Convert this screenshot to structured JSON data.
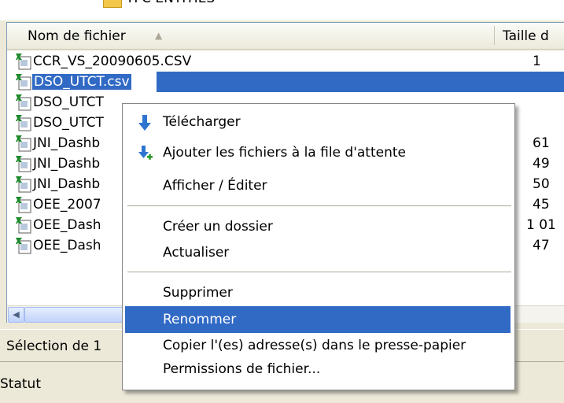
{
  "top_strip": {
    "clipped_text": "TFC ENTITIES"
  },
  "file_list": {
    "columns": [
      "Nom de fichier",
      "Taille d"
    ],
    "rows": [
      {
        "name": "CCR_VS_20090605.CSV",
        "size": "1"
      },
      {
        "name": "DSO_UTCT.csv",
        "size": ""
      },
      {
        "name": "DSO_UTCT",
        "size": ""
      },
      {
        "name": "DSO_UTCT",
        "size": ""
      },
      {
        "name": "JNI_Dashb",
        "size": "61"
      },
      {
        "name": "JNI_Dashb",
        "size": "49"
      },
      {
        "name": "JNI_Dashb",
        "size": "50"
      },
      {
        "name": "OEE_2007",
        "size": "45"
      },
      {
        "name": "OEE_Dash",
        "size": "1 01"
      },
      {
        "name": "OEE_Dash",
        "size": "47"
      }
    ]
  },
  "selection_status": "Sélection de 1",
  "status_label": "Statut",
  "context_menu": {
    "items": [
      {
        "label": "Télécharger"
      },
      {
        "label": "Ajouter les fichiers à la file d'attente"
      },
      {
        "label": "Afficher / Éditer"
      },
      {
        "label": "Créer un dossier"
      },
      {
        "label": "Actualiser"
      },
      {
        "label": "Supprimer"
      },
      {
        "label": "Renommer"
      },
      {
        "label": "Copier l'(es) adresse(s) dans le presse-papier"
      },
      {
        "label": "Permissions de fichier..."
      }
    ]
  },
  "colors": {
    "selection": "#316ac5",
    "background": "#ece9d8",
    "border": "#7f9db9"
  },
  "icons": {
    "file": "spreadsheet-file-icon",
    "download": "download-arrow-icon",
    "queue": "add-queue-icon"
  }
}
